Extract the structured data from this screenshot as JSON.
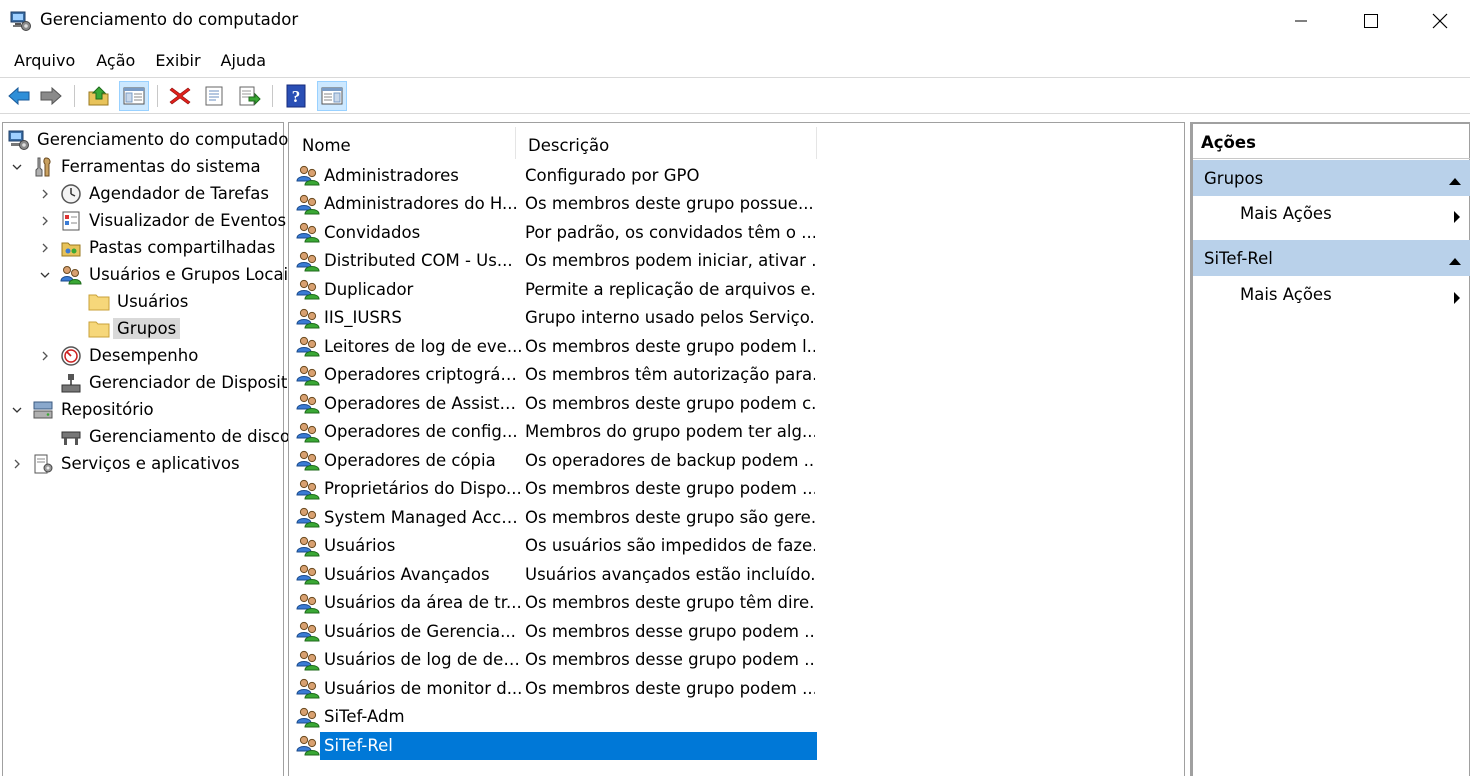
{
  "window": {
    "title": "Gerenciamento do computador"
  },
  "menubar": {
    "items": [
      "Arquivo",
      "Ação",
      "Exibir",
      "Ajuda"
    ]
  },
  "toolbar": {
    "buttons": [
      "back-arrow-icon",
      "forward-arrow-icon",
      "up-folder-icon",
      "show-hide-console-tree-icon",
      "delete-icon",
      "properties-icon",
      "export-list-icon",
      "help-icon",
      "show-hide-action-pane-icon"
    ]
  },
  "tree": {
    "root": "Gerenciamento do computador",
    "system_tools": "Ferramentas do sistema",
    "task_scheduler": "Agendador de Tarefas",
    "event_viewer": "Visualizador de Eventos",
    "shared_folders": "Pastas compartilhadas",
    "local_users_groups": "Usuários e Grupos Locai",
    "users": "Usuários",
    "groups": "Grupos",
    "performance": "Desempenho",
    "device_manager": "Gerenciador de Disposit",
    "storage": "Repositório",
    "disk_management": "Gerenciamento de disco",
    "services_apps": "Serviços e aplicativos"
  },
  "table": {
    "columns": {
      "name": "Nome",
      "description": "Descrição"
    },
    "rows": [
      {
        "name": "Administradores",
        "description": "Configurado por GPO"
      },
      {
        "name": "Administradores do H...",
        "description": "Os membros deste grupo possue..."
      },
      {
        "name": "Convidados",
        "description": "Por padrão, os convidados têm o ..."
      },
      {
        "name": "Distributed COM - Us...",
        "description": "Os membros podem iniciar, ativar ..."
      },
      {
        "name": "Duplicador",
        "description": "Permite a replicação de arquivos e..."
      },
      {
        "name": "IIS_IUSRS",
        "description": "Grupo interno usado pelos Serviço..."
      },
      {
        "name": "Leitores de log de eve...",
        "description": "Os membros deste grupo podem l..."
      },
      {
        "name": "Operadores criptográfi...",
        "description": "Os membros têm autorização para..."
      },
      {
        "name": "Operadores de Assistê...",
        "description": "Os membros deste grupo podem c..."
      },
      {
        "name": "Operadores de config...",
        "description": "Membros do grupo podem ter alg..."
      },
      {
        "name": "Operadores de cópia",
        "description": "Os operadores de backup podem ..."
      },
      {
        "name": "Proprietários do Dispo...",
        "description": "Os membros deste grupo podem ..."
      },
      {
        "name": "System Managed Acco...",
        "description": "Os membros deste grupo são gere..."
      },
      {
        "name": "Usuários",
        "description": "Os usuários são impedidos de faze..."
      },
      {
        "name": "Usuários Avançados",
        "description": "Usuários avançados estão incluído..."
      },
      {
        "name": "Usuários da área de tr...",
        "description": "Os membros deste grupo têm dire..."
      },
      {
        "name": "Usuários de Gerencia...",
        "description": "Os membros desse grupo podem ..."
      },
      {
        "name": "Usuários de log de des...",
        "description": "Os membros desse grupo podem ..."
      },
      {
        "name": "Usuários de monitor d...",
        "description": "Os membros deste grupo podem ..."
      },
      {
        "name": "SiTef-Adm",
        "description": ""
      },
      {
        "name": "SiTef-Rel",
        "description": ""
      }
    ],
    "selected_row": "SiTef-Rel"
  },
  "actions": {
    "title": "Ações",
    "sections": [
      {
        "header": "Grupos",
        "item": "Mais Ações"
      },
      {
        "header": "SiTef-Rel",
        "item": "Mais Ações"
      }
    ]
  },
  "colors": {
    "selection": "#0078d7",
    "action_header": "#b9d1ea",
    "tree_selected": "#d9d9d9"
  }
}
